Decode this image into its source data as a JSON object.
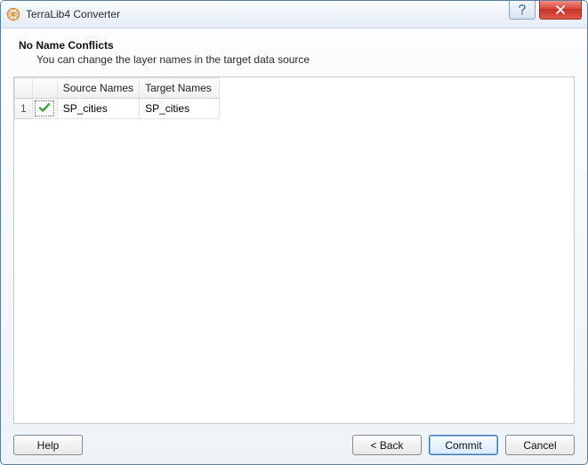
{
  "window": {
    "title": "TerraLib4 Converter"
  },
  "heading": {
    "title": "No Name Conflicts",
    "subtitle": "You can change the layer names in the target data source"
  },
  "table": {
    "columns": {
      "source": "Source Names",
      "target": "Target Names"
    },
    "rows": [
      {
        "num": "1",
        "status": "ok",
        "source": "SP_cities",
        "target": "SP_cities"
      }
    ]
  },
  "buttons": {
    "help": "Help",
    "back": "< Back",
    "commit": "Commit",
    "cancel": "Cancel"
  }
}
